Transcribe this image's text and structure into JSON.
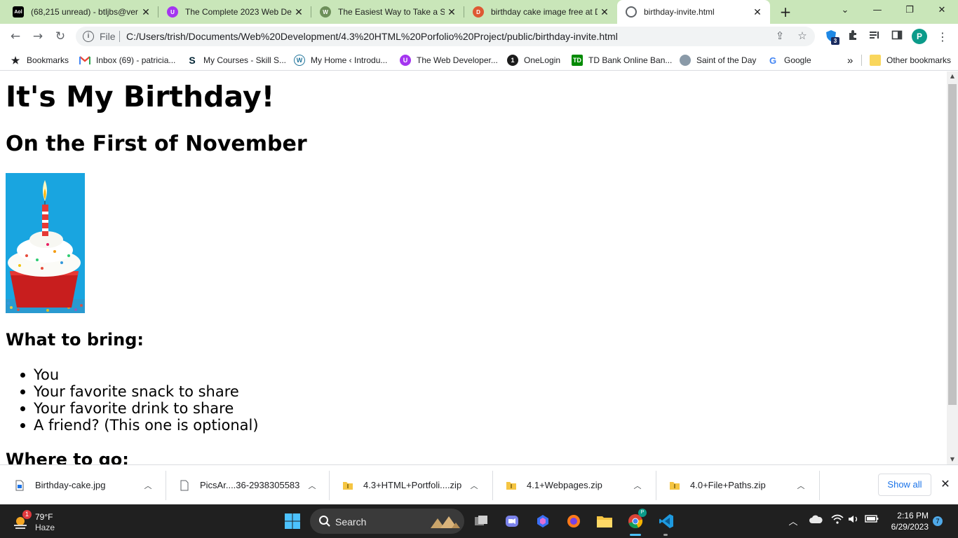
{
  "browser": {
    "tabs": [
      {
        "title": "(68,215 unread) - btljbs@ver",
        "icon": "aol-icon",
        "color": "#000000"
      },
      {
        "title": "The Complete 2023 Web Dev",
        "icon": "udemy-icon",
        "color": "#a435f0"
      },
      {
        "title": "The Easiest Way to Take a Sc",
        "icon": "site-icon",
        "color": "#6d8f5a"
      },
      {
        "title": "birthday cake image free at D",
        "icon": "duckduckgo-icon",
        "color": "#de5833"
      },
      {
        "title": "birthday-invite.html",
        "icon": "globe-icon",
        "color": "#5f6368",
        "active": true
      }
    ],
    "address": {
      "scheme_label": "File",
      "url": "C:/Users/trish/Documents/Web%20Development/4.3%20HTML%20Porfolio%20Project/public/birthday-invite.html"
    },
    "extension_badge": "3",
    "profile_initial": "P",
    "bookmarks": [
      {
        "label": "Bookmarks",
        "icon": "star-icon"
      },
      {
        "label": "Inbox (69) - patricia...",
        "icon": "gmail-icon"
      },
      {
        "label": "My Courses - Skill S...",
        "icon": "skillshare-icon"
      },
      {
        "label": "My Home ‹ Introdu...",
        "icon": "wordpress-icon"
      },
      {
        "label": "The Web Developer...",
        "icon": "udemy-icon"
      },
      {
        "label": "OneLogin",
        "icon": "onelogin-icon"
      },
      {
        "label": "TD Bank Online Ban...",
        "icon": "tdbank-icon"
      },
      {
        "label": "Saint of the Day",
        "icon": "saint-icon"
      },
      {
        "label": "Google",
        "icon": "google-icon"
      }
    ],
    "more_bookmarks": "»",
    "other_bookmarks": "Other bookmarks"
  },
  "page": {
    "title": "It's My Birthday!",
    "subtitle": "On the First of November",
    "image_alt": "cupcake with candle",
    "bring_heading": "What to bring:",
    "bring_items": [
      "You",
      "Your favorite snack to share",
      "Your favorite drink to share",
      "A friend? (This one is optional)"
    ],
    "where_heading": "Where to go:"
  },
  "downloads": {
    "items": [
      {
        "name": "Birthday-cake.jpg",
        "icon": "image-file-icon"
      },
      {
        "name": "PicsAr....36-2938305583",
        "icon": "file-icon"
      },
      {
        "name": "4.3+HTML+Portfoli....zip",
        "icon": "zip-folder-icon"
      },
      {
        "name": "4.1+Webpages.zip",
        "icon": "zip-folder-icon"
      },
      {
        "name": "4.0+File+Paths.zip",
        "icon": "zip-folder-icon"
      }
    ],
    "show_all": "Show all"
  },
  "taskbar": {
    "weather": {
      "temp": "79°F",
      "condition": "Haze",
      "badge": "1"
    },
    "search_label": "Search",
    "time": "2:16 PM",
    "date": "6/29/2023",
    "notification_count": "7"
  }
}
